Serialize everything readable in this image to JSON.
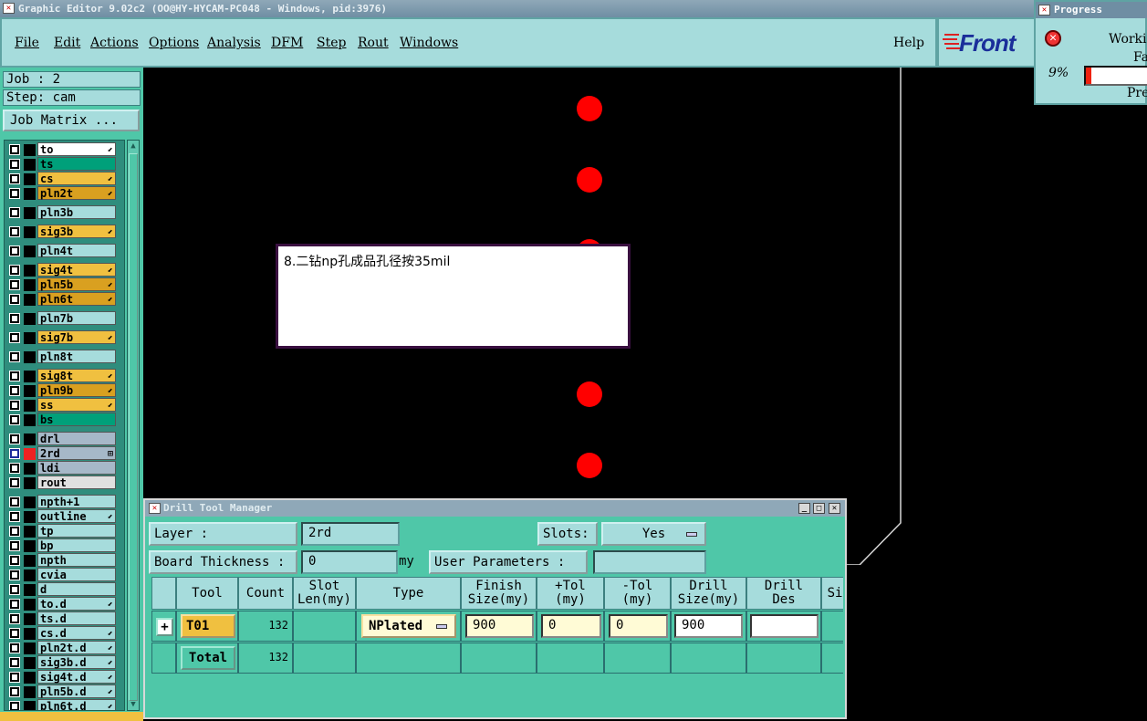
{
  "window_title": "Graphic Editor 9.02c2  (OO@HY-HYCAM-PC048 - Windows, pid:3976)",
  "menu": [
    "File",
    "Edit",
    "Actions",
    "Options",
    "Analysis",
    "DFM",
    "Step",
    "Rout",
    "Windows"
  ],
  "help": "Help",
  "logo": "Front",
  "progress": {
    "title": "Progress",
    "line1": "Workin",
    "line2": "Fa",
    "percent_label": "9%",
    "percent_value": 0.09,
    "line3": "Pre"
  },
  "left": {
    "job": "Job : 2",
    "step": "Step: cam",
    "job_matrix": "Job Matrix ...",
    "layers": [
      {
        "name": "to",
        "color": "#ffffff",
        "flag": "⬋"
      },
      {
        "name": "ts",
        "color": "#00a07a",
        "flag": ""
      },
      {
        "name": "cs",
        "color": "#f0c040",
        "flag": "⬋"
      },
      {
        "name": "pln2t",
        "color": "#d9a020",
        "flag": "⬋"
      },
      {
        "name": "pln3b",
        "color": "#a6dcdc",
        "flag": ""
      },
      {
        "name": "sig3b",
        "color": "#f0c040",
        "flag": "⬋"
      },
      {
        "name": "pln4t",
        "color": "#a6dcdc",
        "flag": ""
      },
      {
        "name": "sig4t",
        "color": "#f0c040",
        "flag": "⬋"
      },
      {
        "name": "pln5b",
        "color": "#d9a020",
        "flag": "⬋"
      },
      {
        "name": "pln6t",
        "color": "#d9a020",
        "flag": "⬋"
      },
      {
        "name": "pln7b",
        "color": "#a6dcdc",
        "flag": ""
      },
      {
        "name": "sig7b",
        "color": "#f0c040",
        "flag": "⬋"
      },
      {
        "name": "pln8t",
        "color": "#a6dcdc",
        "flag": ""
      },
      {
        "name": "sig8t",
        "color": "#f0c040",
        "flag": "⬋"
      },
      {
        "name": "pln9b",
        "color": "#d9a020",
        "flag": "⬋"
      },
      {
        "name": "ss",
        "color": "#f0c040",
        "flag": "⬋"
      },
      {
        "name": "bs",
        "color": "#00a07a",
        "flag": ""
      },
      {
        "name": "drl",
        "color": "#a6b8c8",
        "flag": ""
      },
      {
        "name": "2rd",
        "color": "#a6b8c8",
        "flag": "⊞"
      },
      {
        "name": "ldi",
        "color": "#a6b8c8",
        "flag": ""
      },
      {
        "name": "rout",
        "color": "#e0e0e0",
        "flag": ""
      },
      {
        "name": "npth+1",
        "color": "#a6dcdc",
        "flag": ""
      },
      {
        "name": "outline",
        "color": "#a6dcdc",
        "flag": "⬋"
      },
      {
        "name": "tp",
        "color": "#a6dcdc",
        "flag": ""
      },
      {
        "name": "bp",
        "color": "#a6dcdc",
        "flag": ""
      },
      {
        "name": "npth",
        "color": "#a6dcdc",
        "flag": ""
      },
      {
        "name": "cvia",
        "color": "#a6dcdc",
        "flag": ""
      },
      {
        "name": "d",
        "color": "#a6dcdc",
        "flag": ""
      },
      {
        "name": "to.d",
        "color": "#a6dcdc",
        "flag": "⬋"
      },
      {
        "name": "ts.d",
        "color": "#a6dcdc",
        "flag": ""
      },
      {
        "name": "cs.d",
        "color": "#a6dcdc",
        "flag": "⬋"
      },
      {
        "name": "pln2t.d",
        "color": "#a6dcdc",
        "flag": "⬋"
      },
      {
        "name": "sig3b.d",
        "color": "#a6dcdc",
        "flag": "⬋"
      },
      {
        "name": "sig4t.d",
        "color": "#a6dcdc",
        "flag": "⬋"
      },
      {
        "name": "pln5b.d",
        "color": "#a6dcdc",
        "flag": "⬋"
      },
      {
        "name": "pln6t.d",
        "color": "#a6dcdc",
        "flag": "⬋"
      }
    ]
  },
  "note": "8.二钻np孔成品孔径按35mil",
  "drill_tool_manager": {
    "title": "Drill Tool Manager",
    "layer_label": "Layer          :",
    "layer_value": "2rd",
    "slots_label": "Slots:",
    "slots_value": "Yes",
    "board_thickness_label": "Board Thickness :",
    "board_thickness_value": "0",
    "board_thickness_unit": "my",
    "user_params_label": "User Parameters :",
    "user_params_value": "",
    "columns": [
      {
        "l1": "Tool",
        "l2": ""
      },
      {
        "l1": "Count",
        "l2": ""
      },
      {
        "l1": "Slot",
        "l2": "Len(my)"
      },
      {
        "l1": "Type",
        "l2": ""
      },
      {
        "l1": "Finish",
        "l2": "Size(my)"
      },
      {
        "l1": "+Tol",
        "l2": "(my)"
      },
      {
        "l1": "-Tol",
        "l2": "(my)"
      },
      {
        "l1": "Drill",
        "l2": "Size(my)"
      },
      {
        "l1": "Drill",
        "l2": "Des"
      },
      {
        "l1": "Si",
        "l2": ""
      }
    ],
    "row": {
      "tool": "T01",
      "count": "132",
      "type": "NPlated",
      "finish": "900",
      "ptol": "0",
      "mtol": "0",
      "drill_size": "900",
      "drill_des": ""
    },
    "total": {
      "label": "Total",
      "count": "132"
    }
  }
}
